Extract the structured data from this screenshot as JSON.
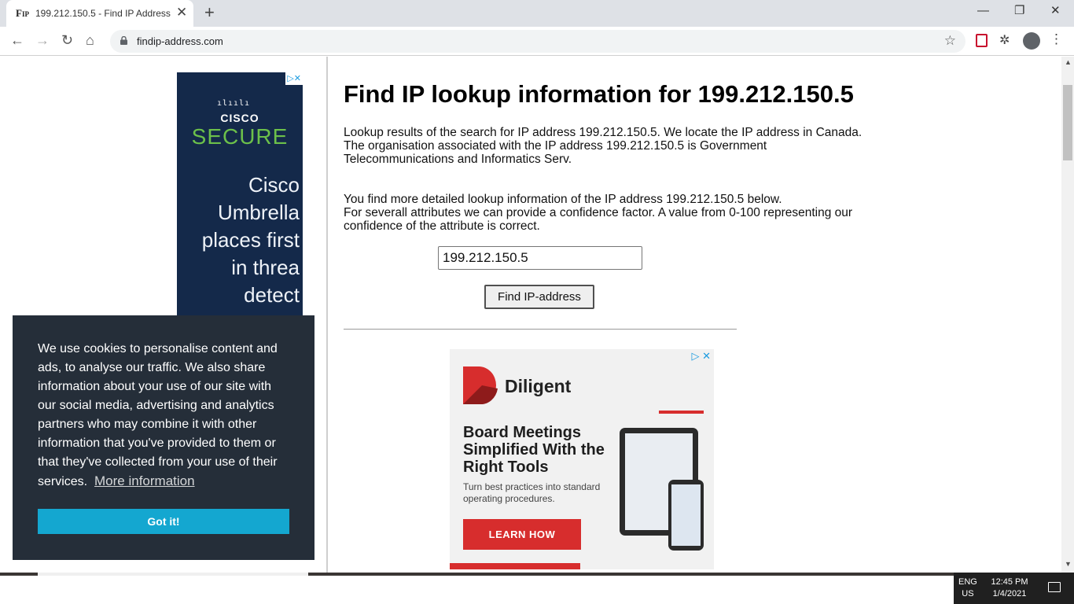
{
  "browser": {
    "tab_favicon": "F",
    "tab_favicon_small": "IP",
    "tab_title": "199.212.150.5 - Find IP Address -",
    "tab_close": "✕",
    "new_tab": "+",
    "url": "findip-address.com",
    "win_minimize": "—",
    "win_restore": "❐",
    "win_close": "✕",
    "back": "←",
    "forward": "→",
    "reload": "↻",
    "home": "⌂",
    "star": "☆",
    "extensions": "✲",
    "menu": "⋮"
  },
  "page": {
    "title": "Find IP lookup information for 199.212.150.5",
    "para1_line1": "Lookup results of the search for IP address 199.212.150.5. We locate the IP address in Canada.",
    "para1_line2": "The organisation associated with the IP address 199.212.150.5 is Government Telecommunications and Informatics Serv.",
    "para2_line1": "You find more detailed lookup information of the IP address 199.212.150.5 below.",
    "para2_line2": "For severall attributes we can provide a confidence factor. A value from 0-100 representing our confidence of the attribute is correct.",
    "ip_input_value": "199.212.150.5",
    "find_button_label": "Find IP-address"
  },
  "ad_left": {
    "badge": "▷✕",
    "logo_bars": "ılıılı",
    "logo_word": "CISCO",
    "logo_secure": "SECURE",
    "copy": "Cisco\nUmbrella\nplaces first\n   in threa\n     detect"
  },
  "ad_diligent": {
    "badge": "▷ ✕",
    "brand": "Diligent",
    "headline": "Board Meetings Simplified With the Right Tools",
    "subhead": "Turn best practices into standard operating procedures.",
    "cta": "LEARN HOW"
  },
  "cookie": {
    "text": "We use cookies to personalise content and ads, to analyse our traffic. We also share information about your use of our site with our social media, advertising and analytics partners who may combine it with other information that you've provided to them or that they've collected from your use of their services.",
    "more_link": "More information",
    "button_label": "Got it!"
  },
  "taskbar": {
    "lang_line1": "ENG",
    "lang_line2": "US",
    "time": "12:45 PM",
    "date": "1/4/2021"
  },
  "colors": {
    "cookie_bg": "#252e39",
    "cookie_button": "#14a7d0",
    "cisco_bg": "#14294a",
    "cisco_green": "#6cc04a",
    "diligent_red": "#d72d2d"
  }
}
